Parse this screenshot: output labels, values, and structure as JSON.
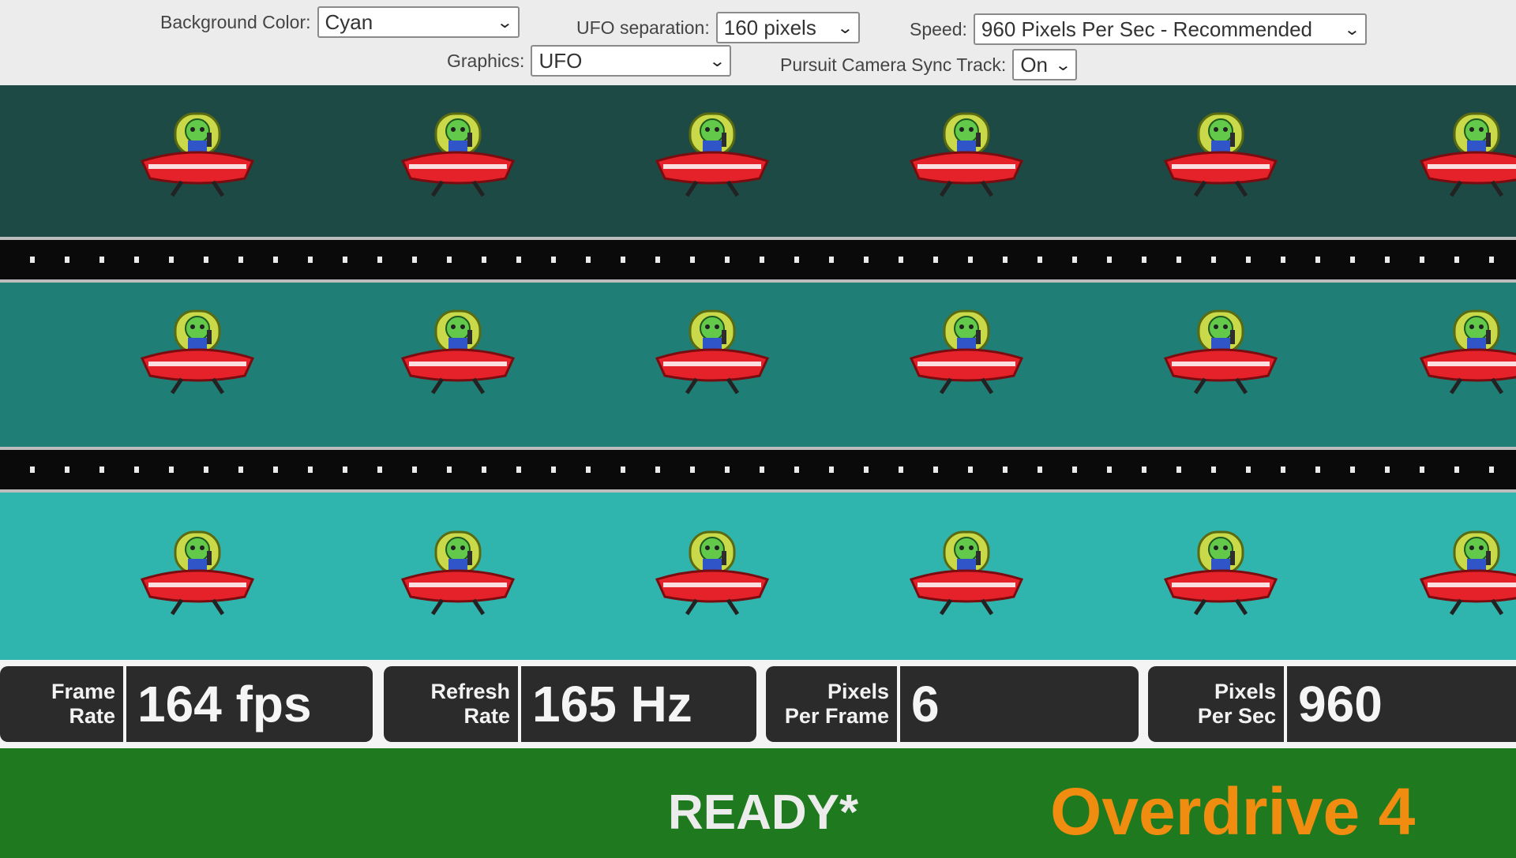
{
  "controls": {
    "background_color": {
      "label": "Background Color:",
      "value": "Cyan"
    },
    "ufo_separation": {
      "label": "UFO separation:",
      "value": "160 pixels"
    },
    "speed": {
      "label": "Speed:",
      "value": "960 Pixels Per Sec - Recommended"
    },
    "graphics": {
      "label": "Graphics:",
      "value": "UFO"
    },
    "pursuit_camera": {
      "label": "Pursuit Camera Sync Track:",
      "value": "On"
    }
  },
  "lanes": [
    {
      "name": "dark-cyan",
      "color": "#1d4a44"
    },
    {
      "name": "medium-cyan",
      "color": "#1f7f77"
    },
    {
      "name": "light-cyan",
      "color": "#2fb5ad"
    }
  ],
  "stats": [
    {
      "label_line1": "Frame",
      "label_line2": "Rate",
      "value": "164 fps"
    },
    {
      "label_line1": "Refresh",
      "label_line2": "Rate",
      "value": "165 Hz"
    },
    {
      "label_line1": "Pixels",
      "label_line2": "Per Frame",
      "value": "6"
    },
    {
      "label_line1": "Pixels",
      "label_line2": "Per Sec",
      "value": "960"
    }
  ],
  "status": {
    "ready": "READY*",
    "overdrive": "Overdrive 4"
  },
  "colors": {
    "accent_orange": "#f08c10",
    "ufo_red": "#e5222a",
    "alien_green": "#62c94a"
  }
}
